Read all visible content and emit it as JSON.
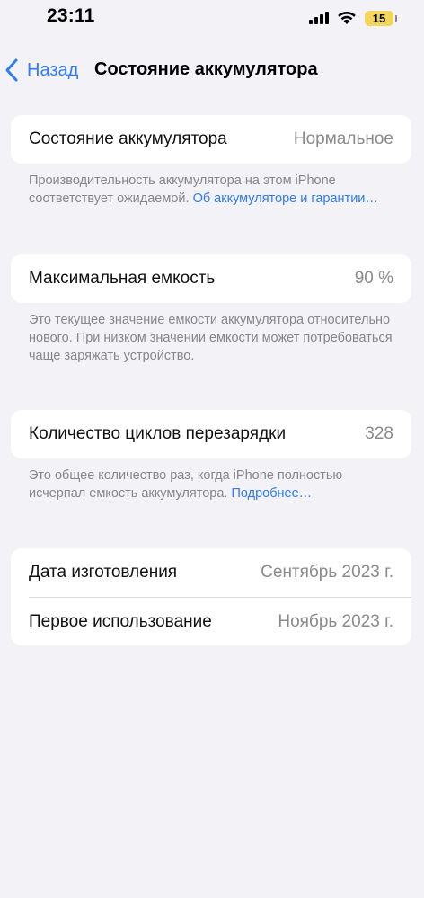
{
  "status_bar": {
    "time": "23:11",
    "battery_level": "15",
    "icons": [
      "signal-icon",
      "wifi-icon",
      "battery-icon"
    ]
  },
  "nav": {
    "back_label": "Назад",
    "title": "Состояние аккумулятора"
  },
  "battery_health": {
    "label": "Состояние аккумулятора",
    "value": "Нормальное",
    "footnote": "Производительность аккумулятора на этом iPhone соответствует ожидаемой.",
    "footnote_link": "Об аккумуляторе и гарантии…"
  },
  "max_capacity": {
    "label": "Максимальная емкость",
    "value": "90 %",
    "footnote": "Это текущее значение емкости аккумулятора относительно нового. При низком значении емкости может потребоваться чаще заряжать устройство."
  },
  "cycle_count": {
    "label": "Количество циклов перезарядки",
    "value": "328",
    "footnote": "Это общее количество раз, когда iPhone полностью исчерпал емкость аккумулятора.",
    "footnote_link": "Подробнее…"
  },
  "dates": {
    "manufacture_label": "Дата изготовления",
    "manufacture_value": "Сентябрь 2023 г.",
    "first_use_label": "Первое использование",
    "first_use_value": "Ноябрь 2023 г."
  },
  "colors": {
    "accent": "#2f7cf6",
    "background": "#f2f2f7",
    "battery": "#f3d65a",
    "secondary_text": "#8a8a8e"
  }
}
